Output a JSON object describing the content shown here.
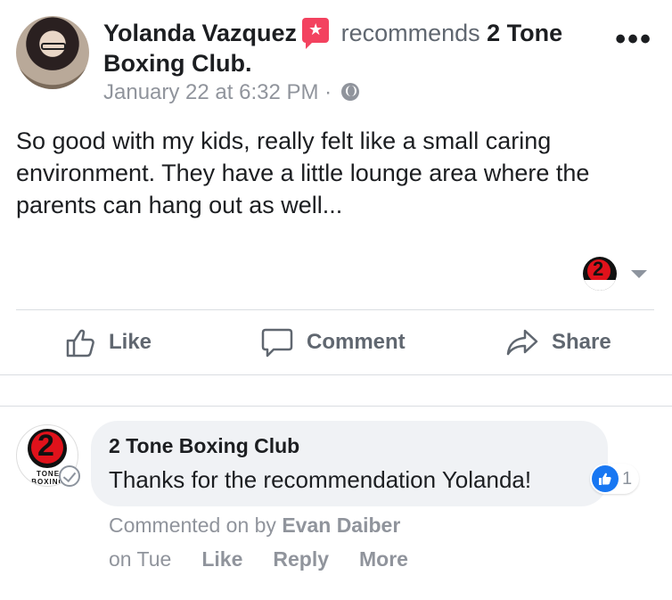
{
  "post": {
    "author": "Yolanda Vazquez",
    "action": "recommends",
    "page_name": "2 Tone Boxing Club.",
    "timestamp": "January 22 at 6:32 PM",
    "timestamp_separator": "·",
    "more_menu": "•••",
    "body": "So good with my kids, really felt like a small caring environment. They have a little lounge area where the parents can hang out as well..."
  },
  "actions": {
    "like": "Like",
    "comment": "Comment",
    "share": "Share"
  },
  "comment": {
    "author": "2 Tone Boxing Club",
    "text": "Thanks for the recommendation Yolanda!",
    "reaction_count": "1",
    "meta_prefix": "Commented on by",
    "meta_name": "Evan Daiber",
    "time": "on Tue",
    "like": "Like",
    "reply": "Reply",
    "more": "More"
  },
  "logo": {
    "number": "2",
    "ring_text": "TONE BOXING CLUB"
  },
  "colors": {
    "recommend_badge": "#f3425f",
    "like_blue": "#1877f2",
    "logo_red": "#e0121b",
    "muted_text": "#90949c"
  },
  "icons": {
    "badge": "star-badge-icon",
    "privacy": "globe-icon",
    "like": "thumbs-up-icon",
    "comment": "speech-bubble-icon",
    "share": "share-arrow-icon",
    "verified": "check-circle-icon",
    "dropdown": "chevron-down-icon"
  }
}
